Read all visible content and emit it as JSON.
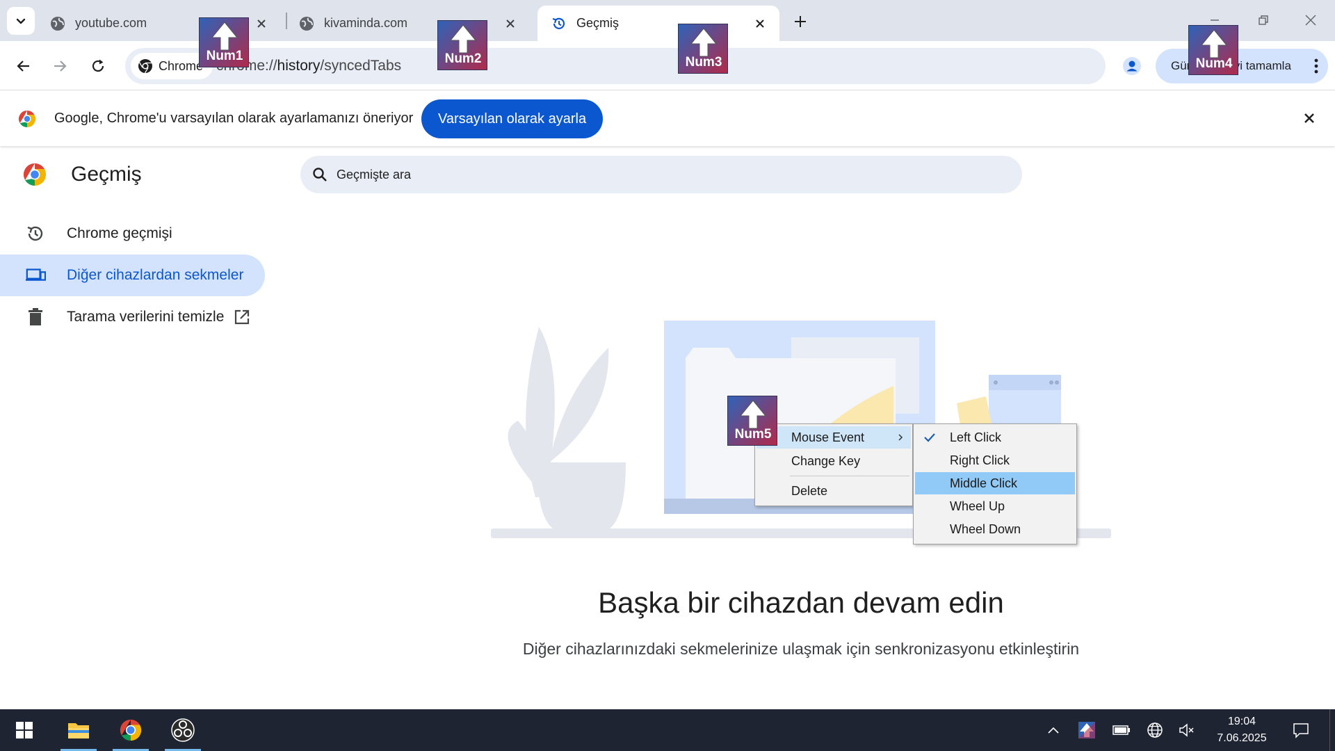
{
  "tabs": [
    {
      "title": "youtube.com",
      "active": false
    },
    {
      "title": "kivaminda.com",
      "active": false
    },
    {
      "title": "Geçmiş",
      "active": true
    }
  ],
  "omnibox": {
    "chip_label": "Chrome",
    "url_prefix": "chrome://",
    "url_host": "history",
    "url_path": "/syncedTabs"
  },
  "update_button": {
    "label": "Güncellemeyi tamamla"
  },
  "infobar": {
    "message": "Google, Chrome'u varsayılan olarak ayarlamanızı öneriyor",
    "button_label": "Varsayılan olarak ayarla"
  },
  "history_page": {
    "title": "Geçmiş",
    "search_placeholder": "Geçmişte ara",
    "sidebar": [
      {
        "label": "Chrome geçmişi",
        "icon": "history-icon",
        "selected": false
      },
      {
        "label": "Diğer cihazlardan sekmeler",
        "icon": "devices-icon",
        "selected": true
      },
      {
        "label": "Tarama verilerini temizle",
        "icon": "trash-icon",
        "selected": false
      }
    ],
    "empty_title": "Başka bir cihazdan devam edin",
    "empty_subtitle": "Diğer cihazlarınızdaki sekmelerinize ulaşmak için senkronizasyonu etkinleştirin"
  },
  "overlay_badges": [
    "Num1",
    "Num2",
    "Num3",
    "Num4",
    "Num5"
  ],
  "context_menu": {
    "items": [
      "Mouse Event",
      "Change Key",
      "Delete"
    ],
    "highlighted": "Mouse Event"
  },
  "submenu": {
    "items": [
      "Left Click",
      "Right Click",
      "Middle Click",
      "Wheel Up",
      "Wheel Down"
    ],
    "checked": "Left Click",
    "highlighted": "Middle Click"
  },
  "clock": {
    "time": "19:04",
    "date": "7.06.2025"
  },
  "colors": {
    "accent": "#0b57d0",
    "tabstrip": "#dfe3eb",
    "selected_bg": "#d3e3fd",
    "taskbar": "#1f2433",
    "menu_highlight": "#91c9f7"
  }
}
